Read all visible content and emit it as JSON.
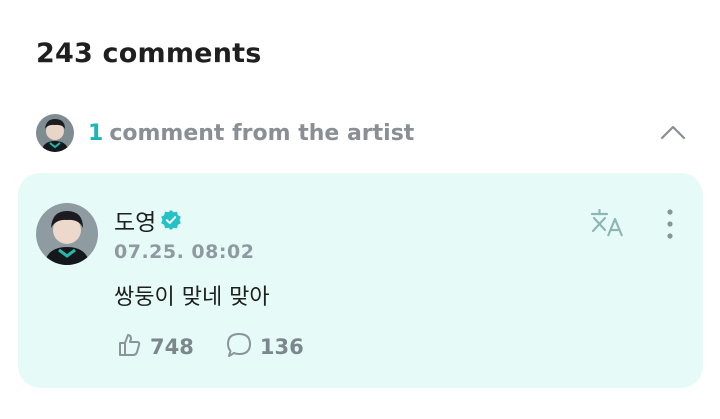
{
  "comments_header": {
    "count_label": "243 comments"
  },
  "artist_section": {
    "count": "1",
    "label": "comment from the artist",
    "avatar_icon": "artist-avatar",
    "collapse_icon": "chevron-up-icon"
  },
  "comment": {
    "author": "도영",
    "verified_icon": "verified-badge-icon",
    "timestamp": "07.25. 08:02",
    "text": "쌍둥이 맞네 맞아",
    "likes": "748",
    "replies": "136",
    "translate_icon": "translate-icon",
    "more_icon": "more-vertical-icon"
  },
  "colors": {
    "accent": "#18b6b6",
    "card_background": "#e6fbf8",
    "muted_text": "#8a8f96"
  }
}
